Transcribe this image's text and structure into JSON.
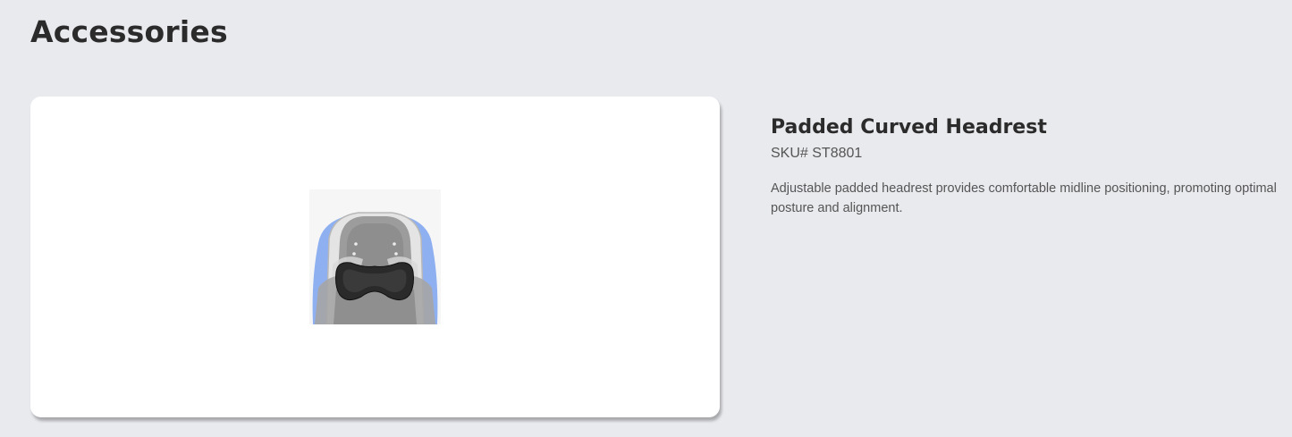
{
  "section": {
    "title": "Accessories"
  },
  "product": {
    "name": "Padded Curved Headrest",
    "sku": "SKU# ST8801",
    "description": "Adjustable padded headrest provides comfortable midline positioning, promoting optimal posture and alignment.",
    "image_icon": "headrest-product-photo"
  },
  "colors": {
    "page_background": "#e9eaee",
    "card_background": "#ffffff",
    "heading_text": "#2b2b2b",
    "body_text": "#555555",
    "seat_accent_blue": "#8fb0f0",
    "headrest_black": "#2a2a2a"
  }
}
